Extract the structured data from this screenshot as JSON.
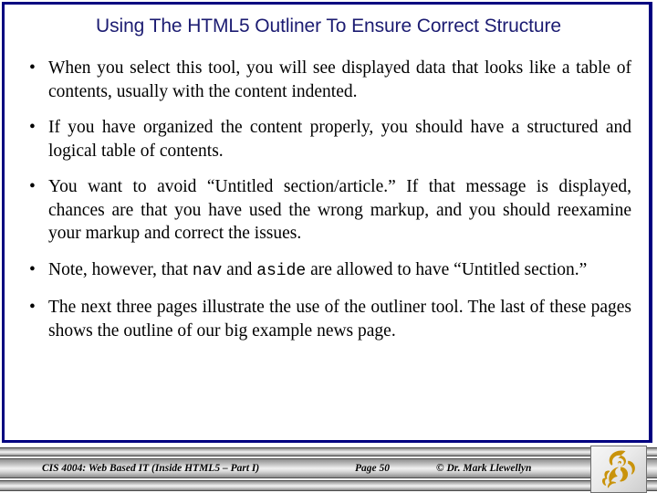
{
  "slide": {
    "title": "Using The HTML5 Outliner To Ensure Correct Structure",
    "title_color": "#1c1c72",
    "border_color": "#000080",
    "background": "#ffffff"
  },
  "bullets": [
    {
      "marker": "•",
      "segments": [
        {
          "type": "text",
          "text": "When you select this tool, you will see displayed data that looks like a table of contents, usually with the content indented."
        }
      ]
    },
    {
      "marker": "•",
      "segments": [
        {
          "type": "text",
          "text": "If you have organized the content properly, you should have a structured and logical table of contents."
        }
      ]
    },
    {
      "marker": "•",
      "segments": [
        {
          "type": "text",
          "text": "You want to avoid “Untitled section/article.”  If that message is displayed, chances are that you have used the wrong markup, and you should reexamine your markup and correct the issues."
        }
      ]
    },
    {
      "marker": "•",
      "segments": [
        {
          "type": "text",
          "text": "Note, however, that "
        },
        {
          "type": "code",
          "text": "nav"
        },
        {
          "type": "text",
          "text": " and "
        },
        {
          "type": "code",
          "text": "aside"
        },
        {
          "type": "text",
          "text": " are allowed to have “Untitled section.”"
        }
      ]
    },
    {
      "marker": "•",
      "segments": [
        {
          "type": "text",
          "text": "The next three pages illustrate the use of the outliner tool.  The last of these pages shows the outline of our big example news page."
        }
      ]
    }
  ],
  "footer": {
    "course": "CIS 4004: Web Based IT (Inside HTML5 – Part I)",
    "page": "Page 50",
    "author": "© Dr. Mark Llewellyn",
    "logo_icon": "ucf-pegasus-logo",
    "logo_color": "#C9930B"
  }
}
